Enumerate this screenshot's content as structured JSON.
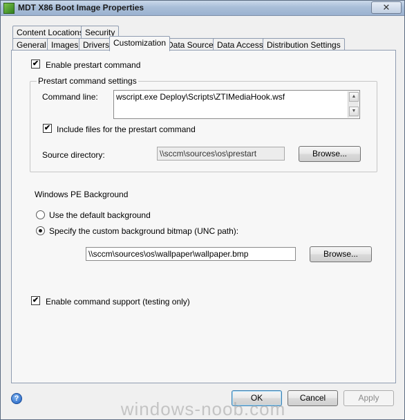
{
  "window": {
    "title": "MDT X86 Boot Image Properties",
    "close_glyph": "✕"
  },
  "tabs_row1": [
    {
      "label": "Content Locations"
    },
    {
      "label": "Security"
    }
  ],
  "tabs_row2": [
    {
      "label": "General"
    },
    {
      "label": "Images"
    },
    {
      "label": "Drivers"
    },
    {
      "label": "Customization",
      "active": true
    },
    {
      "label": "Data Source"
    },
    {
      "label": "Data Access"
    },
    {
      "label": "Distribution Settings"
    }
  ],
  "customization": {
    "enable_prestart": {
      "label": "Enable prestart command",
      "checked": true,
      "mark": "✔"
    },
    "prestart_group": {
      "title": "Prestart command settings",
      "command_line_label": "Command line:",
      "command_line_value": "wscript.exe Deploy\\Scripts\\ZTIMediaHook.wsf",
      "include_files": {
        "label": "Include files for the prestart command",
        "checked": true,
        "mark": "✔"
      },
      "source_dir_label": "Source directory:",
      "source_dir_value": "\\\\sccm\\sources\\os\\prestart",
      "browse_label": "Browse..."
    },
    "background": {
      "title": "Windows PE Background",
      "option_default": {
        "label": "Use the default background",
        "selected": false
      },
      "option_custom": {
        "label": "Specify the custom background bitmap (UNC path):",
        "selected": true
      },
      "path_value": "\\\\sccm\\sources\\os\\wallpaper\\wallpaper.bmp",
      "browse_label": "Browse..."
    },
    "enable_cmd_support": {
      "label": "Enable command support (testing only)",
      "checked": true,
      "mark": "✔"
    }
  },
  "footer": {
    "help_glyph": "?",
    "ok_label": "OK",
    "cancel_label": "Cancel",
    "apply_label": "Apply"
  },
  "watermark": "windows-noob.com",
  "colors": {
    "titlebar": "#a9bed8",
    "dialog_bg": "#f0f0f0",
    "panel_bg": "#f7f7f7",
    "default_button_border": "#3c7fb1"
  }
}
